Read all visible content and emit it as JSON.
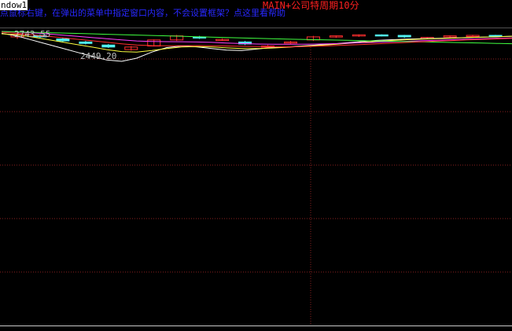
{
  "window": {
    "label": "ndow1"
  },
  "header": {
    "period_title": "MAIN+公司特周期10分",
    "hint": "点鼠标右键，在弹出的菜单中指定窗口内容，不会设置框架？点这里看帮助"
  },
  "price_labels": {
    "high": "2743.55",
    "low": "2449.20"
  },
  "colors": {
    "background": "#000000",
    "grid": "#8a1f1f",
    "border": "#c8c8c8",
    "title": "#ff2020",
    "hint": "#2828ff",
    "up_candle": "#ff2e2e",
    "down_candle": "#50f0f0",
    "ma_white": "#ffffff",
    "ma_yellow": "#ffff40",
    "ma_magenta": "#ff40ff",
    "ma_green": "#40ff40",
    "ma_red": "#ff3030"
  },
  "chart_data": {
    "type": "line",
    "price_range": [
      2449.2,
      2743.55
    ],
    "series": [
      {
        "color_key": "ma_white",
        "values": [
          2725,
          2700,
          2660,
          2620,
          2580,
          2540,
          2500,
          2462,
          2449.2,
          2480,
          2540,
          2585,
          2600,
          2592,
          2575,
          2560,
          2555,
          2570,
          2585,
          2590,
          2600,
          2610,
          2620,
          2632,
          2645,
          2655,
          2662,
          2668,
          2672,
          2676,
          2680,
          2684,
          2688,
          2692,
          2696
        ]
      },
      {
        "color_key": "ma_yellow",
        "values": [
          2720,
          2710,
          2690,
          2665,
          2640,
          2615,
          2590,
          2565,
          2545,
          2540,
          2555,
          2575,
          2590,
          2595,
          2590,
          2582,
          2575,
          2575,
          2580,
          2588,
          2596,
          2605,
          2615,
          2625,
          2636,
          2646,
          2655,
          2662,
          2668,
          2673,
          2678,
          2683,
          2688,
          2692,
          2696
        ]
      },
      {
        "color_key": "ma_magenta",
        "values": [
          2743.55,
          2738,
          2730,
          2720,
          2708,
          2696,
          2684,
          2672,
          2660,
          2650,
          2645,
          2643,
          2642,
          2640,
          2636,
          2630,
          2624,
          2620,
          2618,
          2617,
          2618,
          2620,
          2623,
          2627,
          2632,
          2637,
          2642,
          2647,
          2652,
          2657,
          2662,
          2667,
          2671,
          2675,
          2679
        ]
      },
      {
        "color_key": "ma_green",
        "values": [
          2743,
          2740,
          2736,
          2732,
          2728,
          2724,
          2720,
          2716,
          2712,
          2708,
          2704,
          2700,
          2696,
          2692,
          2688,
          2684,
          2680,
          2676,
          2672,
          2668,
          2665,
          2662,
          2659,
          2656,
          2653,
          2650,
          2647,
          2644,
          2641,
          2638,
          2635,
          2632,
          2629,
          2626,
          2623
        ]
      },
      {
        "color_key": "ma_red",
        "values": [
          2735,
          2725,
          2712,
          2697,
          2682,
          2667,
          2652,
          2637,
          2622,
          2610,
          2604,
          2602,
          2603,
          2604,
          2603,
          2600,
          2597,
          2594,
          2592,
          2592,
          2594,
          2598,
          2603,
          2609,
          2615,
          2621,
          2628,
          2635,
          2642,
          2648,
          2654,
          2660,
          2665,
          2670,
          2675
        ]
      }
    ],
    "candles": [
      {
        "o": 2690,
        "c": 2715,
        "h": 2738,
        "l": 2670
      },
      {
        "o": 2705,
        "c": 2690,
        "h": 2715,
        "l": 2680
      },
      {
        "o": 2670,
        "c": 2650,
        "h": 2680,
        "l": 2640
      },
      {
        "o": 2640,
        "c": 2625,
        "h": 2650,
        "l": 2615
      },
      {
        "o": 2610,
        "c": 2590,
        "h": 2620,
        "l": 2580
      },
      {
        "o": 2565,
        "c": 2590,
        "h": 2600,
        "l": 2555
      },
      {
        "o": 2600,
        "c": 2660,
        "h": 2665,
        "l": 2595
      },
      {
        "o": 2660,
        "c": 2700,
        "h": 2710,
        "l": 2650
      },
      {
        "o": 2690,
        "c": 2680,
        "h": 2700,
        "l": 2670
      },
      {
        "o": 2660,
        "c": 2665,
        "h": 2675,
        "l": 2650
      },
      {
        "o": 2640,
        "c": 2620,
        "h": 2650,
        "l": 2610
      },
      {
        "o": 2590,
        "c": 2600,
        "h": 2610,
        "l": 2580
      },
      {
        "o": 2630,
        "c": 2640,
        "h": 2650,
        "l": 2620
      },
      {
        "o": 2660,
        "c": 2690,
        "h": 2700,
        "l": 2650
      },
      {
        "o": 2690,
        "c": 2700,
        "h": 2705,
        "l": 2680
      },
      {
        "o": 2700,
        "c": 2710,
        "h": 2715,
        "l": 2690
      },
      {
        "o": 2710,
        "c": 2705,
        "h": 2715,
        "l": 2695
      },
      {
        "o": 2705,
        "c": 2690,
        "h": 2710,
        "l": 2680
      },
      {
        "o": 2680,
        "c": 2685,
        "h": 2690,
        "l": 2670
      },
      {
        "o": 2690,
        "c": 2700,
        "h": 2705,
        "l": 2680
      },
      {
        "o": 2700,
        "c": 2705,
        "h": 2710,
        "l": 2690
      },
      {
        "o": 2705,
        "c": 2700,
        "h": 2710,
        "l": 2695
      }
    ]
  }
}
